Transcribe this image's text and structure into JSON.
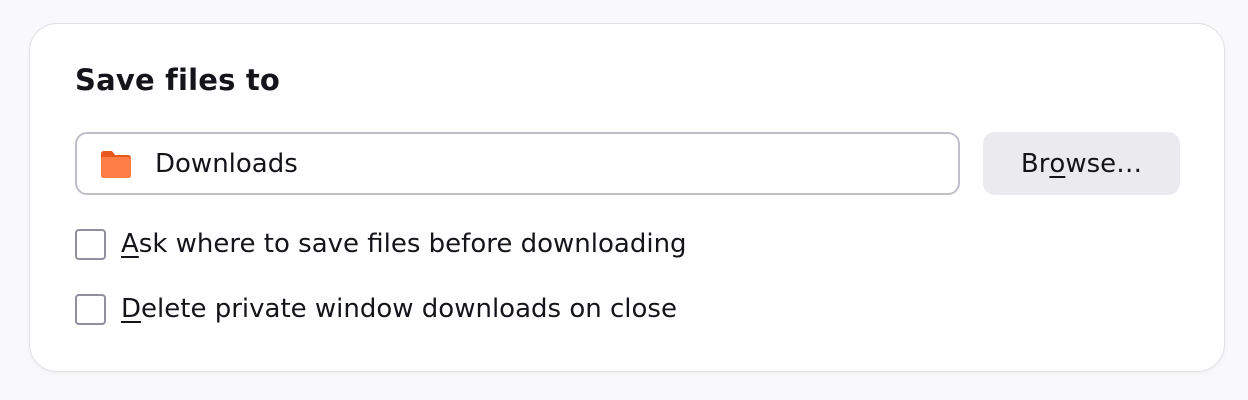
{
  "section": {
    "title": "Save files to"
  },
  "path_field": {
    "value": "Downloads",
    "icon": "folder-icon",
    "icon_color": "#ff7139"
  },
  "browse_button": {
    "label_pre": "Br",
    "label_access": "o",
    "label_post": "wse…"
  },
  "options": [
    {
      "access_key": "A",
      "label_rest": "sk where to save files before downloading",
      "checked": false
    },
    {
      "access_key": "D",
      "label_rest": "elete private window downloads on close",
      "checked": false
    }
  ]
}
